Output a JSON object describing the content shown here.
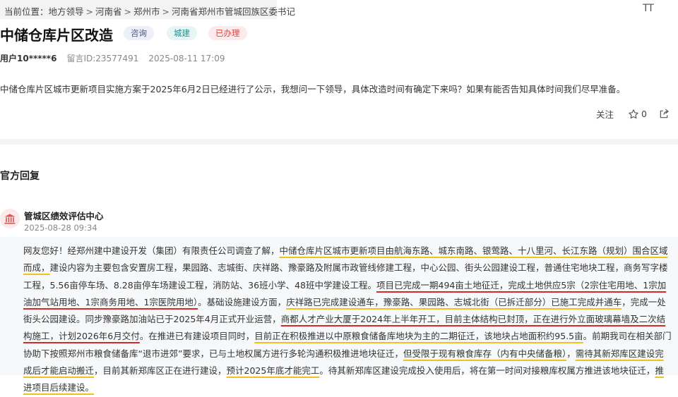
{
  "breadcrumb": {
    "prefix": "当前位置：",
    "items": [
      "地方领导",
      "河南省",
      "郑州市",
      "河南省郑州市管城回族区委书记"
    ],
    "separator": ">"
  },
  "font_toggle": "TT",
  "message": {
    "title": "中储仓库片区改造",
    "tags": [
      "咨询",
      "城建",
      "已办理"
    ],
    "user": "用户10*****6",
    "message_id": "留言ID:23577491",
    "datetime": "2025-08-11 17:09",
    "body": "中储仓库片区城市更新项目实施方案于2025年6月2日已经进行了公示，我想问一下领导，具体改造时间有确定下来吗？如果有能否告知具体时间我们尽早准备。"
  },
  "actions": {
    "follow_label": "关注",
    "like_count": "0"
  },
  "reply": {
    "section_title": "官方回复",
    "department": "管城区绩效评估中心",
    "datetime": "2025-08-28 09:34",
    "segments": [
      {
        "text": "网友您好！经郑州建中建设开发（集团）有限责任公司调查了解，",
        "mark": ""
      },
      {
        "text": "中储仓库片区城市更新项目由航海东路、城东南路、银莺路、十八里河、长江东路（规划）围合区域而成，",
        "mark": "yellow"
      },
      {
        "text": "建设内容为主要包含安置房工程，果园路、志城街、庆祥路、豫豪路及附属市政管线修建工程，中心公园、街头公园建设工程，普通住宅地块工程，商务写字楼工程，5.56亩停车场、8.28亩停车场建设工程，消防站、36班小学、48班中学建设工程。",
        "mark": ""
      },
      {
        "text": "项目已完成一期494亩土地征迁，完成土地供应5宗（2宗住宅用地、1宗加油加气站用地、1宗商务用地、1宗医院用地）",
        "mark": "red"
      },
      {
        "text": "。基础设施建设方面，",
        "mark": ""
      },
      {
        "text": "庆祥路已完成建设通车，豫豪路、果园路、志城北街（已拆迁部分）已施工完成并通车",
        "mark": "yellow"
      },
      {
        "text": "，完成一处街头公园建设。同步豫豪路加油站已于2025年4月正式开业运营，",
        "mark": ""
      },
      {
        "text": "商都人才产业大厦于2024年上半年开工，目前主体结构已封顶，正在进行外立面玻璃幕墙及二次结构施工，计划2026年6月交付",
        "mark": "red"
      },
      {
        "text": "。在推进已有建设项目同时，",
        "mark": ""
      },
      {
        "text": "目前正在积极推进以中原粮食储备库地块为主的二期征迁，该地块占地面积约95.5亩",
        "mark": "yellow"
      },
      {
        "text": "。前期我司在相关部门协助下按照郑州市粮食储备库“退市进郊”要求，已与土地权属方进行多轮沟通积极推进地块征迁，",
        "mark": ""
      },
      {
        "text": "但受限于现有粮食库存（内有中央储备粮）",
        "mark": "yellow"
      },
      {
        "text": "，",
        "mark": ""
      },
      {
        "text": "需待其新郑库区建设完成后才能启动搬迁",
        "mark": "yellow"
      },
      {
        "text": "，目前其新郑库区正在进行建设，",
        "mark": ""
      },
      {
        "text": "预计2025年底才能完工",
        "mark": "yellow"
      },
      {
        "text": "。待其新郑库区建设完成投入使用后，将在第一时间对接粮库权属方推进该地块征迁，",
        "mark": ""
      },
      {
        "text": "推进项目后续建设。",
        "mark": "yellow"
      }
    ]
  },
  "colors": {
    "tag_consult_bg": "#eef0f7",
    "tag_urban_bg": "#e6f6f6",
    "tag_done_bg": "#fdeaea",
    "underline_yellow": "#f1c21b",
    "underline_red": "#d62a2a"
  }
}
